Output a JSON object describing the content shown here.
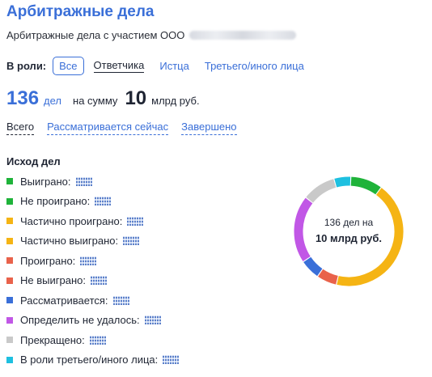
{
  "header": {
    "title": "Арбитражные дела",
    "subtitle": "Арбитражные дела с участием ООО"
  },
  "roles": {
    "label": "В роли:",
    "options": [
      "Все",
      "Ответчика",
      "Истца",
      "Третьего/иного лица"
    ]
  },
  "totals": {
    "count": "136",
    "count_unit": "дел",
    "sum_label": "на сумму",
    "amount": "10",
    "amount_unit": "млрд руб."
  },
  "filters": [
    "Всего",
    "Рассматривается сейчас",
    "Завершено"
  ],
  "outcomes": {
    "heading": "Исход дел",
    "items": [
      {
        "label": "Выиграно:",
        "color": "#1fb33a",
        "icon": "redacted-value-icon"
      },
      {
        "label": "Не проиграно:",
        "color": "#1fb33a",
        "icon": "redacted-value-icon"
      },
      {
        "label": "Частично проиграно:",
        "color": "#f5b414",
        "icon": "redacted-value-icon"
      },
      {
        "label": "Частично выиграно:",
        "color": "#f5b414",
        "icon": "redacted-value-icon"
      },
      {
        "label": "Проиграно:",
        "color": "#e9624b",
        "icon": "redacted-value-icon"
      },
      {
        "label": "Не выиграно:",
        "color": "#e9624b",
        "icon": "redacted-value-icon"
      },
      {
        "label": "Рассматривается:",
        "color": "#3a6fd8",
        "icon": "redacted-value-icon"
      },
      {
        "label": "Определить не удалось:",
        "color": "#c157e6",
        "icon": "redacted-value-icon"
      },
      {
        "label": "Прекращено:",
        "color": "#c9c9c9",
        "icon": "redacted-value-icon"
      },
      {
        "label": "В роли третьего/иного лица:",
        "color": "#1ec0e0",
        "icon": "redacted-value-icon"
      }
    ]
  },
  "donut": {
    "center_line1": "136 дел на",
    "center_line2": "10 млрд руб.",
    "segments": [
      {
        "name": "win",
        "share": 0.095,
        "color": "#1fb33a"
      },
      {
        "name": "partial",
        "share": 0.435,
        "color": "#f5b414"
      },
      {
        "name": "lost",
        "share": 0.06,
        "color": "#e9624b"
      },
      {
        "name": "pending",
        "share": 0.06,
        "color": "#3a6fd8"
      },
      {
        "name": "undetermined",
        "share": 0.2,
        "color": "#c157e6"
      },
      {
        "name": "terminated",
        "share": 0.1,
        "color": "#c9c9c9"
      },
      {
        "name": "third-party",
        "share": 0.05,
        "color": "#1ec0e0"
      }
    ]
  }
}
